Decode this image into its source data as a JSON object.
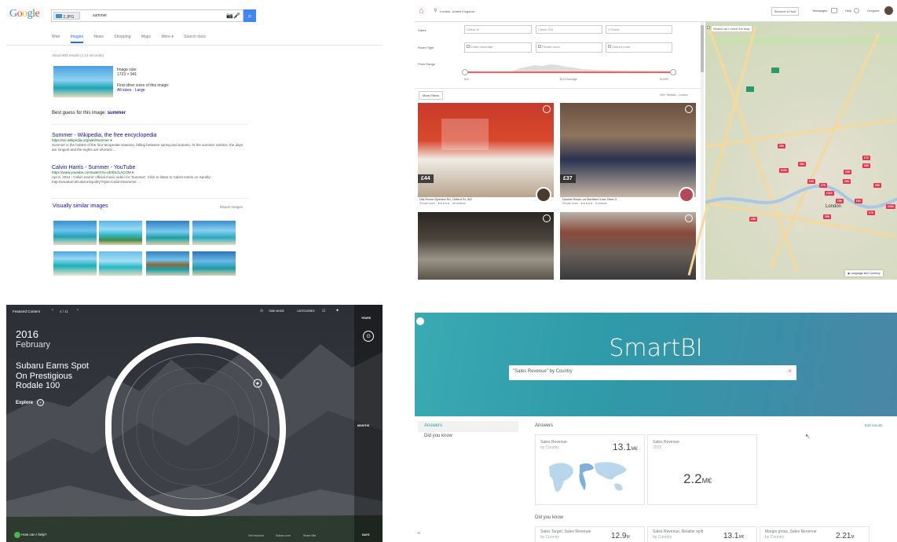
{
  "google": {
    "logo": "Google",
    "search_chip": "2.JPG",
    "search_query": "summer",
    "tabs": [
      "Web",
      "Images",
      "News",
      "Shopping",
      "Maps",
      "More ▾",
      "Search tools"
    ],
    "results_count": "About 903 results (1.13 seconds)",
    "image_size_label": "Image size:",
    "image_size_value": "1723 × 941",
    "find_other_sizes": "Find other sizes of this image:",
    "sizes_links": "All sizes · Large",
    "best_guess_label": "Best guess for this image:",
    "best_guess_value": "summer",
    "results": [
      {
        "title": "Summer - Wikipedia, the free encyclopedia",
        "url": "https://en.wikipedia.org/wiki/Summer ▾",
        "snippet": "Summer is the hottest of the four temperate seasons, falling between spring and autumn. At the summer solstice, the days are longest and the nights are shortest ..."
      },
      {
        "title": "Calvin Harris - Summer - YouTube",
        "url": "https://www.youtube.com/watch?v=ebXbLfLACGM ▾",
        "snippet": "Apr 6, 2014 - Calvin Harris' official music video for 'Summer'. Click to listen to Calvin Harris on Spotify: http://smarturl.it/CalvinHSpotify?IQid=CalvinHSummer ..."
      }
    ],
    "similar_title": "Visually similar images",
    "report_images": "Report images"
  },
  "airbnb": {
    "location": "London, United Kingdom",
    "nav": [
      "Become a Host",
      "Messages",
      "Help",
      "Gregorie"
    ],
    "dates_label": "Dates",
    "check_in": "Check In",
    "check_out": "Check Out",
    "guests": "1 Guest",
    "room_type_label": "Room Type",
    "room_types": [
      "Entire home/apt",
      "Private room",
      "Shared room"
    ],
    "price_label": "Price Range",
    "price_min": "$10",
    "price_avg": "$123 Average",
    "price_max": "$1000+",
    "more_filters": "More Filters",
    "results_text": "300+ Rentals · London",
    "map_check": "Search as I move the map",
    "map_footer": "Language and Currency",
    "map_city": "London",
    "listings": [
      {
        "price": "£44",
        "title": "Old Room Opened Rd, Oxford St, W2",
        "sub": "Private room · ★★★★★ · 48 reviews"
      },
      {
        "price": "£37",
        "title": "Double Room on Northern Line Zone 3",
        "sub": "Private room · ★★★★★ · 8 reviews"
      },
      {
        "price": "",
        "title": "",
        "sub": ""
      },
      {
        "price": "",
        "title": "",
        "sub": ""
      }
    ],
    "map_markers": [
      "£89",
      "£64",
      "£120",
      "£49",
      "£75",
      "£99",
      "£85",
      "£69",
      "£110",
      "£59",
      "£92",
      "£78",
      "£105",
      "£65",
      "£88",
      "£55",
      "£72"
    ]
  },
  "subaru": {
    "featured": "Featured Content",
    "pager": "4 / 11",
    "year": "2016",
    "month": "February",
    "headline_1": "Subaru Earns Spot",
    "headline_2": "On Prestigious",
    "headline_3": "Rodale 100",
    "explore": "Explore",
    "timemode": "TIME MODE",
    "categories": "CATEGORIES",
    "years": "YEARS",
    "months": "MONTHS",
    "days": "DAYS",
    "help": "How can I help?",
    "footer_links": [
      "Get Involved",
      "Subaru.com",
      "Share Site"
    ]
  },
  "smartbi": {
    "title": "SmartBI",
    "query": "\"Sales Revenue\" by Country",
    "side_answers": "Answers",
    "side_dyk": "Did you know",
    "answers_heading": "Answers",
    "edit_results": "Edit results",
    "card1_title": "Sales Revenue",
    "card1_sub": "by Country",
    "card1_value": "13.1",
    "card1_unit": "M€",
    "card2_title": "Sales Revenue",
    "card2_sub": "2015",
    "card2_value": "2.2",
    "card2_unit": "M€",
    "dyk_heading": "Did you know",
    "dyk": [
      {
        "title": "Sales Target, Sales Revenue",
        "sub": "by Country",
        "value": "12.9",
        "unit": "M"
      },
      {
        "title": "Sales Revenue, Retailer split",
        "sub": "by Country",
        "value": "13.1",
        "unit": "M€"
      },
      {
        "title": "Margin gross, Sales Revenue",
        "sub": "by Country",
        "value": "2.21",
        "unit": "M"
      }
    ]
  }
}
